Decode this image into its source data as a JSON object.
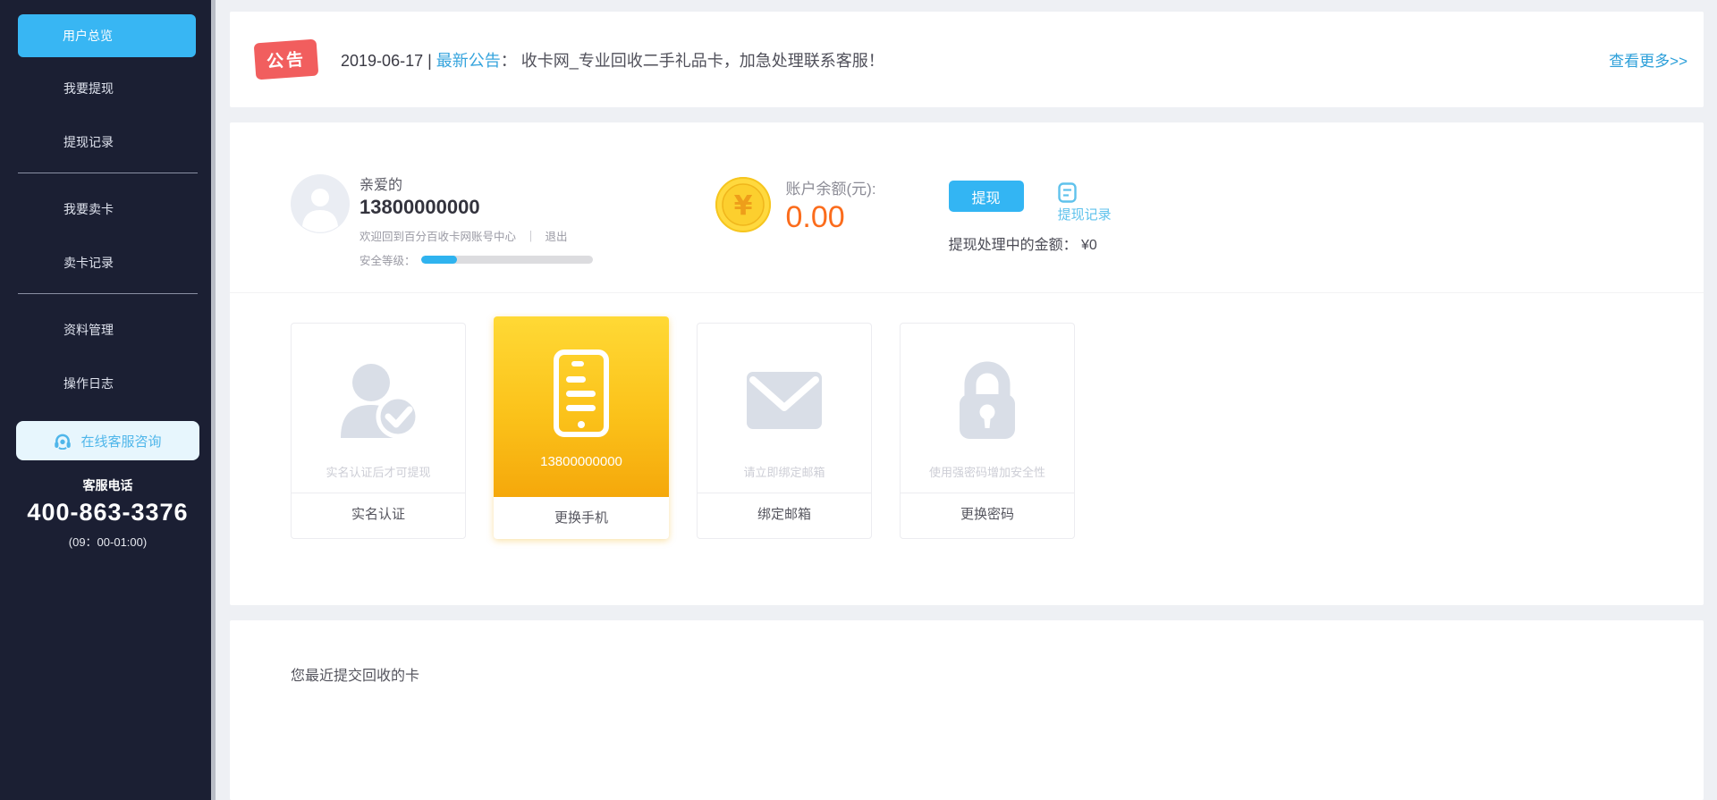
{
  "sidebar": {
    "menu": [
      {
        "label": "用户总览",
        "active": true
      },
      {
        "label": "我要提现"
      },
      {
        "label": "提现记录"
      },
      {
        "label": "我要卖卡"
      },
      {
        "label": "卖卡记录"
      },
      {
        "label": "资料管理"
      },
      {
        "label": "操作日志"
      }
    ],
    "service_button": "在线客服咨询",
    "hotline_label": "客服电话",
    "hotline_number": "400-863-3376",
    "hotline_hours": "(09：00-01:00)"
  },
  "announcement": {
    "badge": "公告",
    "date": "2019-06-17",
    "separator": " | ",
    "label": "最新公告",
    "colon": "： ",
    "text": "收卡网_专业回收二手礼品卡，加急处理联系客服！",
    "more_link": "查看更多>>"
  },
  "account": {
    "greeting": "亲爱的",
    "username": "13800000000",
    "welcome": "欢迎回到百分百收卡网账号中心",
    "pipe": "｜",
    "logout": "退出",
    "security_label": "安全等级：",
    "security_percent": 21,
    "balance_label": "账户余额(元):",
    "balance_value": "0.00",
    "coin_symbol": "¥",
    "withdraw_button": "提现",
    "withdraw_record_link": "提现记录",
    "pending_label": "提现处理中的金额：",
    "pending_value": "¥0"
  },
  "cards": [
    {
      "icon": "person-check-icon",
      "caption": "实名认证后才可提现",
      "footer": "实名认证"
    },
    {
      "icon": "phone-icon",
      "caption": "13800000000",
      "footer": "更换手机",
      "highlight": true
    },
    {
      "icon": "envelope-icon",
      "caption": "请立即绑定邮箱",
      "footer": "绑定邮箱"
    },
    {
      "icon": "lock-icon",
      "caption": "使用强密码增加安全性",
      "footer": "更换密码"
    }
  ],
  "recent": {
    "title": "您最近提交回收的卡"
  },
  "colors": {
    "sidebar_bg": "#1b1f33",
    "active_menu": "#38b6f3",
    "accent_blue": "#33b5f3",
    "link_blue": "#2c9fd9",
    "badge_red": "#f15e5e",
    "balance_orange": "#fb6c1c",
    "card_gold_top": "#ffd935",
    "card_gold_bottom": "#f5a80b"
  }
}
